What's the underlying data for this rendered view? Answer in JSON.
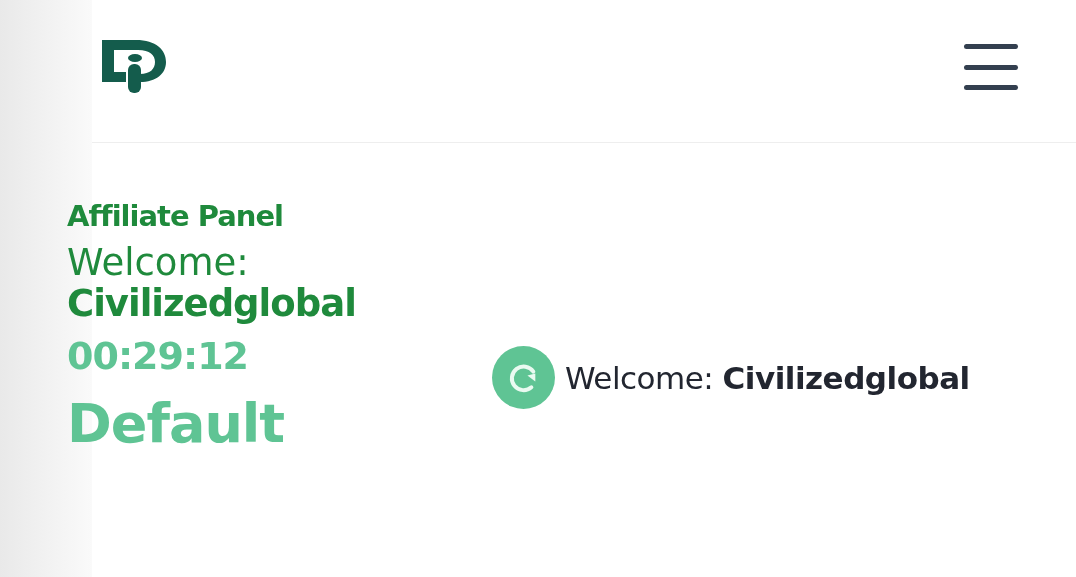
{
  "panel": {
    "title": "Affiliate Panel",
    "welcome_label": "Welcome:",
    "username": "Civilizedglobal",
    "timer": "00:29:12",
    "plan": "Default"
  },
  "greeting": {
    "text": "Welcome: **Civilizedglobal**"
  }
}
